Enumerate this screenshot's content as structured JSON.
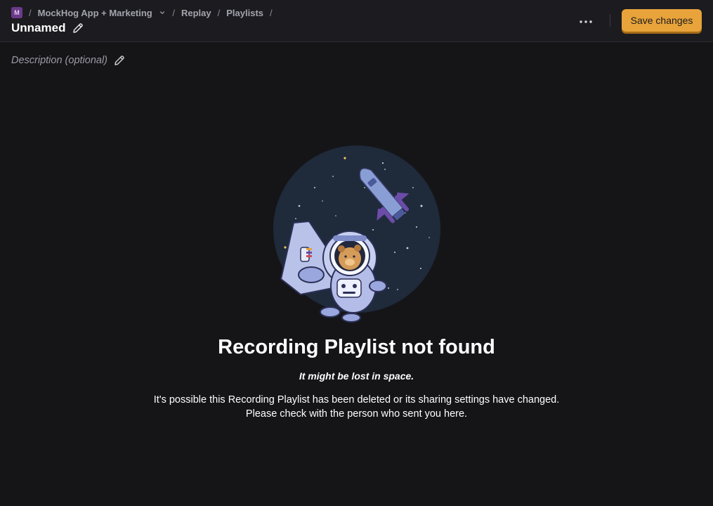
{
  "header": {
    "project_badge": "M",
    "breadcrumbs": [
      "MockHog App + Marketing",
      "Replay",
      "Playlists"
    ],
    "title": "Unnamed",
    "save_label": "Save changes"
  },
  "description": {
    "placeholder": "Description (optional)"
  },
  "not_found": {
    "title": "Recording Playlist not found",
    "subtitle": "It might be lost in space.",
    "body_line1": "It's possible this Recording Playlist has been deleted or its sharing settings have changed.",
    "body_line2": "Please check with the person who sent you here."
  },
  "colors": {
    "background": "#151518",
    "topbar": "#1c1c20",
    "accent": "#e8a33a",
    "space": "#1f2a3b"
  },
  "icons": {
    "edit": "pencil-icon",
    "more": "more-horizontal-icon",
    "dropdown": "chevron-down-icon"
  }
}
